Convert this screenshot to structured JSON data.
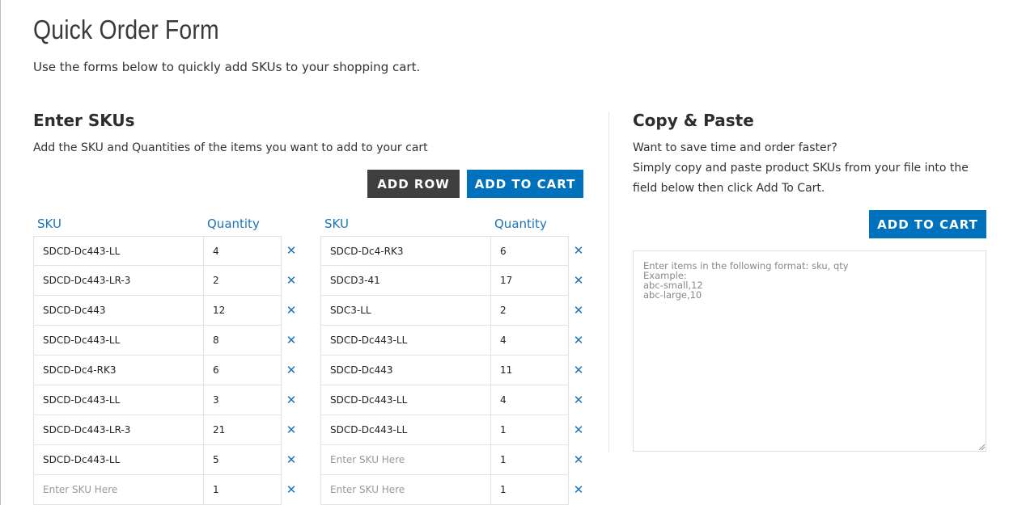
{
  "header": {
    "title": "Quick Order Form",
    "intro": "Use the forms below to quickly add SKUs to your shopping cart."
  },
  "enter_skus": {
    "title": "Enter SKUs",
    "subtitle": "Add the SKU and Quantities of the items you want to add to your cart",
    "add_row_label": "ADD ROW",
    "add_to_cart_label": "ADD TO CART",
    "sku_header": "SKU",
    "qty_header": "Quantity",
    "remove_glyph": "✕",
    "sku_placeholder": "Enter SKU Here",
    "left_rows": [
      {
        "sku": "SDCD-Dc443-LL",
        "qty": "4"
      },
      {
        "sku": "SDCD-Dc443-LR-3",
        "qty": "2"
      },
      {
        "sku": "SDCD-Dc443",
        "qty": "12"
      },
      {
        "sku": "SDCD-Dc443-LL",
        "qty": "8"
      },
      {
        "sku": "SDCD-Dc4-RK3",
        "qty": "6"
      },
      {
        "sku": "SDCD-Dc443-LL",
        "qty": "3"
      },
      {
        "sku": "SDCD-Dc443-LR-3",
        "qty": "21"
      },
      {
        "sku": "SDCD-Dc443-LL",
        "qty": "5"
      },
      {
        "sku": "",
        "qty": "1"
      }
    ],
    "right_rows": [
      {
        "sku": "SDCD-Dc4-RK3",
        "qty": "6"
      },
      {
        "sku": "SDCD3-41",
        "qty": "17"
      },
      {
        "sku": "SDC3-LL",
        "qty": "2"
      },
      {
        "sku": "SDCD-Dc443-LL",
        "qty": "4"
      },
      {
        "sku": "SDCD-Dc443",
        "qty": "11"
      },
      {
        "sku": "SDCD-Dc443-LL",
        "qty": "4"
      },
      {
        "sku": "SDCD-Dc443-LL",
        "qty": "1"
      },
      {
        "sku": "",
        "qty": "1"
      },
      {
        "sku": "",
        "qty": "1"
      }
    ]
  },
  "copy_paste": {
    "title": "Copy & Paste",
    "line1": "Want to save time and order faster?",
    "line2": "Simply copy and paste product SKUs from your file into the",
    "line3": "field below then click Add To Cart.",
    "add_to_cart_label": "ADD TO CART",
    "placeholder": "Enter items in the following format: sku, qty\nExample:\nabc-small,12\nabc-large,10"
  },
  "colors": {
    "accent": "#0071bc",
    "dark_button": "#3f3f3f",
    "header_blue": "#1b74b9"
  }
}
